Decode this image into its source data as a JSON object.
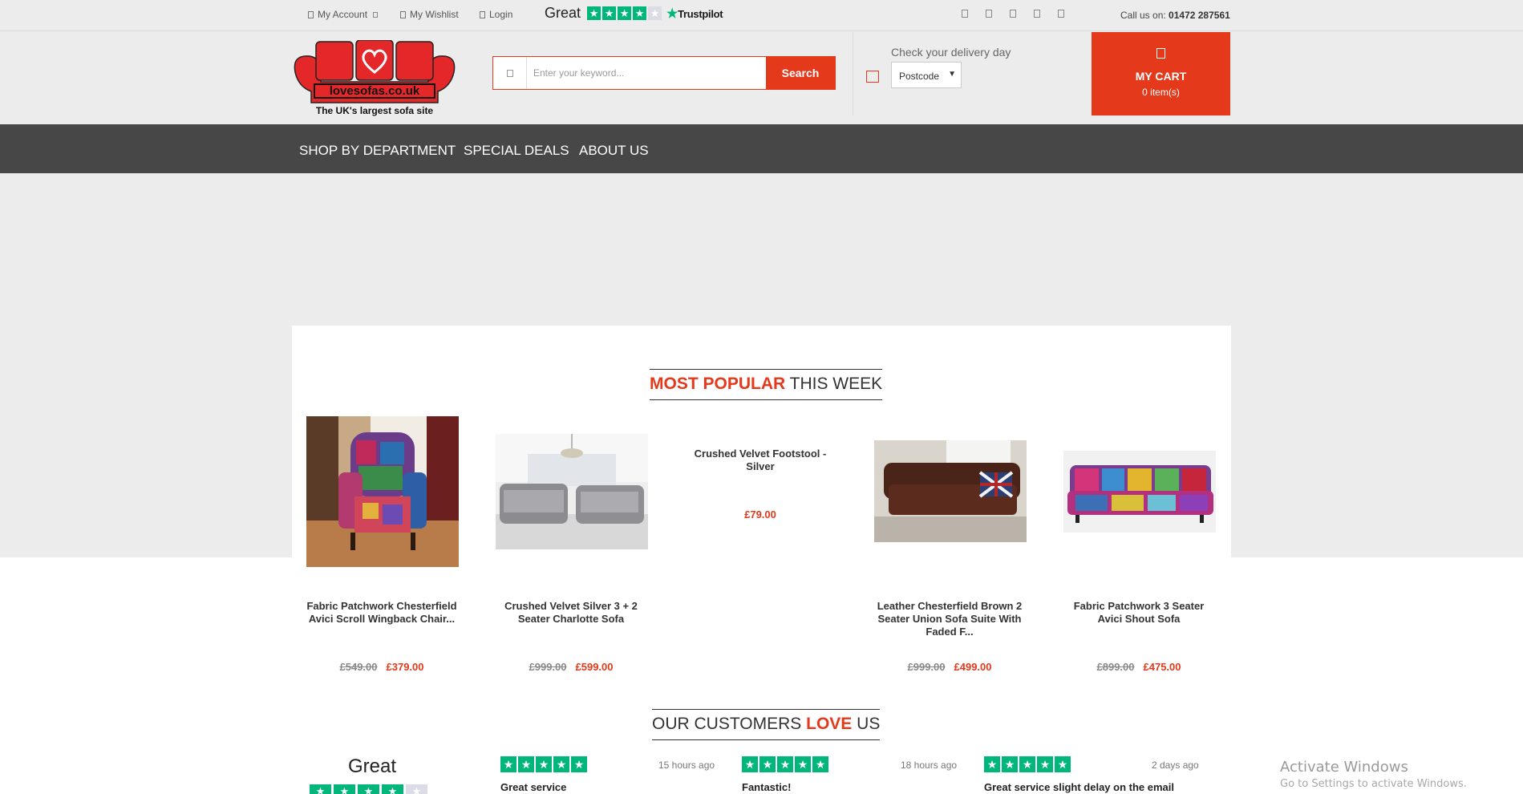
{
  "topbar": {
    "my_account": "My Account",
    "my_wishlist": "My Wishlist",
    "login": "Login",
    "trustpilot_rating": "Great",
    "trustpilot_brand": "Trustpilot",
    "trustpilot_stars": 4,
    "social_icons": [
      "facebook-icon",
      "twitter-icon",
      "google-plus-icon",
      "pinterest-icon",
      "instagram-icon"
    ],
    "call_label": "Call us on:",
    "phone": "01472 287561"
  },
  "header": {
    "logo_text": "lovesofas.co.uk",
    "logo_tagline": "The UK's largest sofa site",
    "search_placeholder": "Enter your keyword...",
    "search_button": "Search",
    "delivery_label": "Check your delivery day",
    "postcode_value": "Postcode",
    "cart_title": "MY CART",
    "cart_count": "0 item(s)"
  },
  "nav": {
    "items": [
      "SHOP BY DEPARTMENT",
      "SPECIAL DEALS",
      "ABOUT US"
    ]
  },
  "popular": {
    "title_highlight": "MOST POPULAR",
    "title_rest": " THIS WEEK",
    "products": [
      {
        "name": "Fabric Patchwork Chesterfield Avici Scroll Wingback Chair...",
        "old_price": "£549.00",
        "price": "£379.00"
      },
      {
        "name": "Crushed Velvet Silver 3 + 2 Seater Charlotte Sofa",
        "old_price": "£999.00",
        "price": "£599.00"
      },
      {
        "name": "Crushed Velvet Footstool - Silver",
        "old_price": "",
        "price": "£79.00"
      },
      {
        "name": "Leather Chesterfield Brown 2 Seater Union Sofa Suite With Faded F...",
        "old_price": "£999.00",
        "price": "£499.00"
      },
      {
        "name": "Fabric Patchwork 3 Seater Avici Shout Sofa",
        "old_price": "£899.00",
        "price": "£475.00"
      }
    ]
  },
  "reviews": {
    "title_pre": "OUR CUSTOMERS ",
    "title_highlight": "LOVE",
    "title_post": " US",
    "summary_rating": "Great",
    "summary_stars": 4,
    "items": [
      {
        "time": "15 hours ago",
        "title": "Great service",
        "stars": 5
      },
      {
        "time": "18 hours ago",
        "title": "Fantastic!",
        "stars": 5
      },
      {
        "time": "2 days ago",
        "title": "Great service slight delay on the email",
        "stars": 5
      }
    ]
  },
  "watermark": {
    "line1": "Activate Windows",
    "line2": "Go to Settings to activate Windows."
  },
  "colors": {
    "accent": "#e4391b",
    "nav_bg": "#474747",
    "trustpilot_green": "#00b67a",
    "page_bg": "#ececec"
  }
}
